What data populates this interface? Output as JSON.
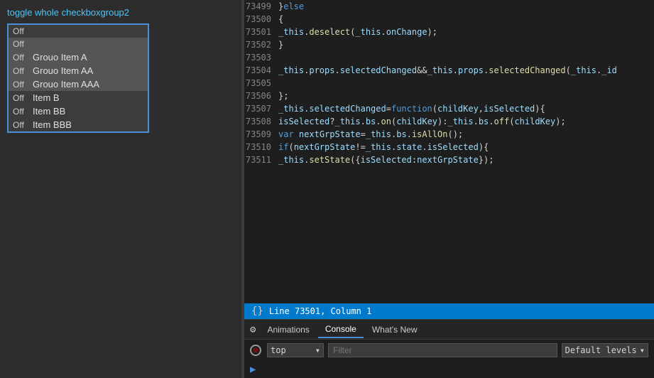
{
  "leftPanel": {
    "toggleLabel": "toggle whole checkboxgroup2",
    "checkboxItems": [
      {
        "status": "Off",
        "label": "",
        "isHeader": true,
        "highlighted": true
      },
      {
        "status": "Off",
        "label": "",
        "isOff": true,
        "highlighted": true
      },
      {
        "status": "Off",
        "label": "Grouo Item A",
        "highlighted": true
      },
      {
        "status": "Off",
        "label": "Grouo Item AA",
        "highlighted": true
      },
      {
        "status": "Off",
        "label": "Grouo Item AAA",
        "highlighted": true
      },
      {
        "status": "Off",
        "label": "Item B",
        "highlighted": false
      },
      {
        "status": "Off",
        "label": "Item BB",
        "highlighted": false
      },
      {
        "status": "Off",
        "label": "Item BBB",
        "highlighted": false
      }
    ]
  },
  "codeEditor": {
    "lines": [
      {
        "num": "73499",
        "content": "}else"
      },
      {
        "num": "73500",
        "content": "{"
      },
      {
        "num": "73501",
        "content": "_this.deselect(_this.onChange);"
      },
      {
        "num": "73502",
        "content": "}"
      },
      {
        "num": "73503",
        "content": ""
      },
      {
        "num": "73504",
        "content": "_this.props.selectedChanged&&_this.props.selectedChanged(_this._id"
      },
      {
        "num": "73505",
        "content": ""
      },
      {
        "num": "73506",
        "content": "};"
      },
      {
        "num": "73507",
        "content": "_this.selectedChanged=function(childKey,isSelected){"
      },
      {
        "num": "73508",
        "content": "isSelected?_this.bs.on(childKey):_this.bs.off(childKey);"
      },
      {
        "num": "73509",
        "content": "var nextGrpState=_this.bs.isAllOn();"
      },
      {
        "num": "73510",
        "content": "if(nextGrpState!=_this.state.isSelected){"
      },
      {
        "num": "73511",
        "content": "_this.setState({isSelected:nextGrpState});"
      }
    ],
    "statusBar": {
      "icon": "{}",
      "text": "Line 73501, Column 1"
    }
  },
  "devtools": {
    "tabs": [
      {
        "label": "Animations",
        "active": false
      },
      {
        "label": "Console",
        "active": true
      },
      {
        "label": "What's New",
        "active": false
      }
    ],
    "toolbar": {
      "noEntryIcon": "🚫",
      "topLabel": "top",
      "filterPlaceholder": "Filter",
      "levelsLabel": "Default levels",
      "arrowLabel": ">"
    }
  }
}
